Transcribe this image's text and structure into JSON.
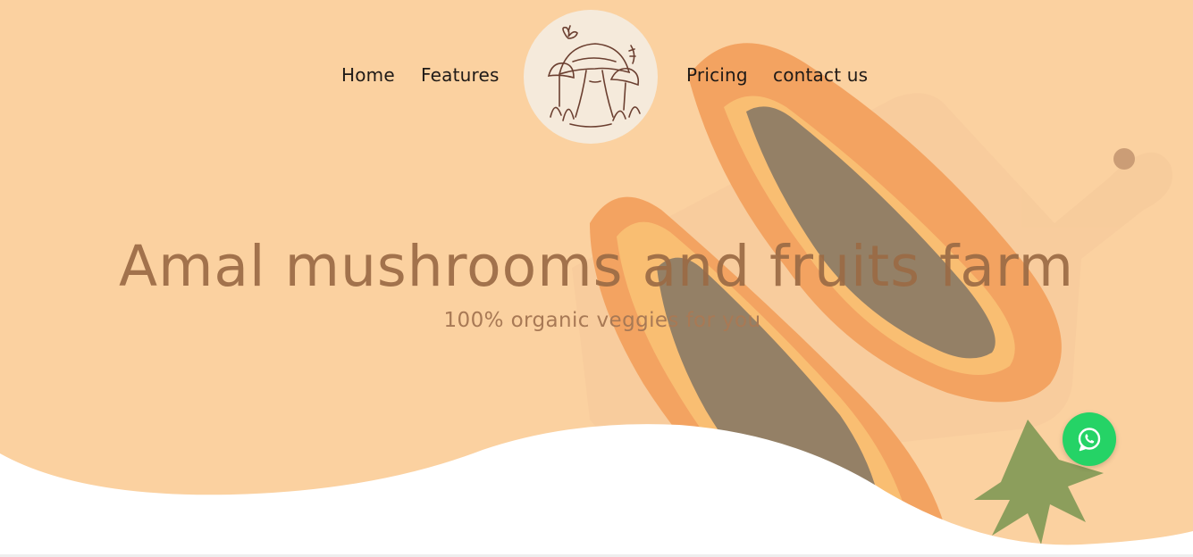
{
  "nav": {
    "items": [
      {
        "label": "Home"
      },
      {
        "label": "Features"
      },
      {
        "label": "Pricing"
      },
      {
        "label": "contact us"
      }
    ],
    "logo_icon": "mushroom-logo-icon"
  },
  "hero": {
    "title": "Amal mushrooms and fruits farm",
    "subtitle": "100% organic veggies for you",
    "image_subject": "papaya-halves-on-cutting-board"
  },
  "chat": {
    "icon": "whatsapp-icon",
    "color": "#25d366"
  },
  "colors": {
    "hero_background": "#fbd1a0",
    "title": "#9b6b45",
    "subtitle": "#a87955",
    "logo_background": "#f5eadb"
  }
}
